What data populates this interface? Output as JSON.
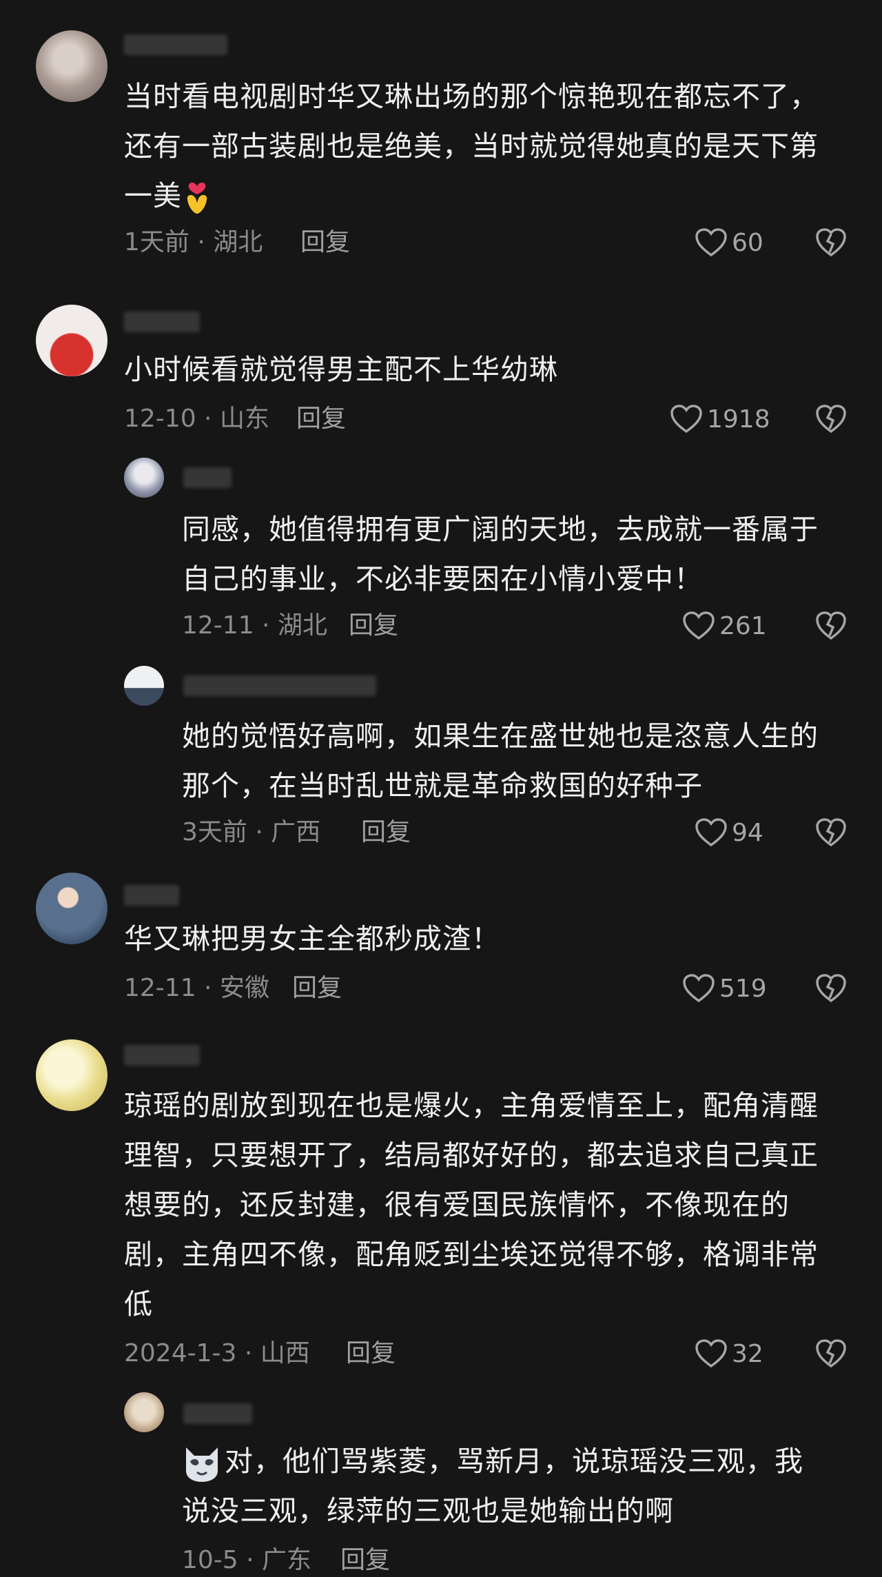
{
  "theme": {
    "background": "#161616",
    "text": "#efefef",
    "meta": "#8b8b8b",
    "icon": "#a6a6a6"
  },
  "reply_label": "回复",
  "comments": [
    {
      "line1": "当时看电视剧时华又琳出场的那个惊艳现在都忘不了，",
      "line2": "还有一部古装剧也是绝美，当时就觉得她真的是天下第",
      "line3": "一美",
      "meta": "1天前 · 湖北",
      "likes": "60"
    },
    {
      "line1": "小时候看就觉得男主配不上华幼琳",
      "meta": "12-10 · 山东",
      "likes": "1918"
    },
    {
      "line1": "同感，她值得拥有更广阔的天地，去成就一番属于",
      "line2": "自己的事业，不必非要困在小情小爱中！",
      "meta": "12-11 · 湖北",
      "likes": "261"
    },
    {
      "line1": "她的觉悟好高啊，如果生在盛世她也是恣意人生的",
      "line2": "那个，在当时乱世就是革命救国的好种子",
      "meta": "3天前 · 广西",
      "likes": "94"
    },
    {
      "line1": "华又琳把男女主全都秒成渣！",
      "meta": "12-11 · 安徽",
      "likes": "519"
    },
    {
      "line1": "琼瑶的剧放到现在也是爆火，主角爱情至上，配角清醒",
      "line2": "理智，只要想开了，结局都好好的，都去追求自己真正",
      "line3": "想要的，还反封建，很有爱国民族情怀，不像现在的",
      "line4": "剧，主角四不像，配角贬到尘埃还觉得不够，格调非常",
      "line5": "低",
      "meta": "2024-1-3 · 山西",
      "likes": "32"
    },
    {
      "line1": "对，他们骂紫菱，骂新月，说琼瑶没三观，我",
      "line2": "说没三观，绿萍的三观也是她输出的啊",
      "meta": "10-5 · 广东"
    }
  ]
}
